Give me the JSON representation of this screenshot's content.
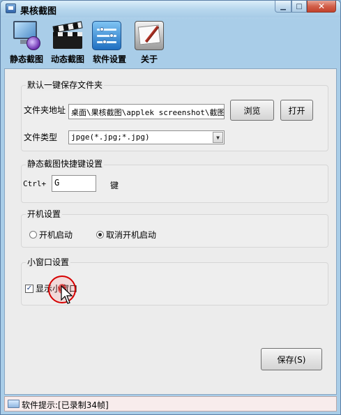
{
  "window": {
    "title": "果核截图"
  },
  "toolbar": {
    "items": [
      {
        "label": "静态截图",
        "icon": "monitor-disc-icon"
      },
      {
        "label": "动态截图",
        "icon": "clapperboard-icon"
      },
      {
        "label": "软件设置",
        "icon": "settings-panel-icon"
      },
      {
        "label": "关于",
        "icon": "notepad-pen-icon"
      }
    ]
  },
  "save_folder": {
    "group_title": "默认一键保存文件夹",
    "path_label": "文件夹地址",
    "path_value": "桌面\\果核截图\\applek  screenshot\\截图",
    "browse_label": "浏览",
    "open_label": "打开",
    "type_label": "文件类型",
    "type_value": "jpge(*.jpg;*.jpg)"
  },
  "hotkey": {
    "group_title": "静态截图快捷键设置",
    "prefix": "Ctrl+",
    "key_value": "G",
    "suffix": "键"
  },
  "startup": {
    "group_title": "开机设置",
    "options": [
      {
        "label": "开机启动",
        "selected": false
      },
      {
        "label": "取消开机启动",
        "selected": true
      }
    ]
  },
  "mini_window": {
    "group_title": "小窗口设置",
    "checkbox_label": "显示小窗口",
    "checked": true
  },
  "save_button": {
    "label": "保存(S)"
  },
  "status": {
    "text": "软件提示:[已录制34帧]"
  },
  "colors": {
    "title_bar": "#b8d8ee",
    "close_button": "#c2412b",
    "client_bg": "#ececec",
    "status_bg": "#f8ecec"
  }
}
